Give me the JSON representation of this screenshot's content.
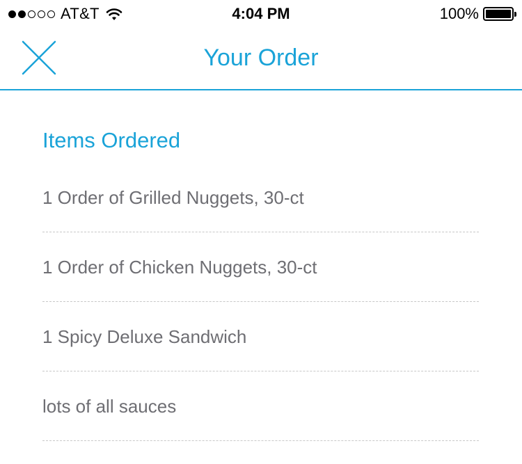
{
  "status_bar": {
    "carrier": "AT&T",
    "signal_strength": 2,
    "signal_max": 5,
    "time": "4:04 PM",
    "battery": "100%",
    "battery_level": 1.0,
    "icons": [
      "signal-dots-icon",
      "wifi-icon",
      "battery-icon"
    ]
  },
  "nav": {
    "title": "Your Order",
    "close_icon": "close-icon",
    "accent_color": "#1aa3d8"
  },
  "section": {
    "title": "Items Ordered"
  },
  "items": [
    {
      "label": "1 Order of Grilled Nuggets, 30-ct"
    },
    {
      "label": "1 Order of Chicken Nuggets, 30-ct"
    },
    {
      "label": "1 Spicy Deluxe Sandwich"
    },
    {
      "label": "lots of all sauces"
    }
  ]
}
